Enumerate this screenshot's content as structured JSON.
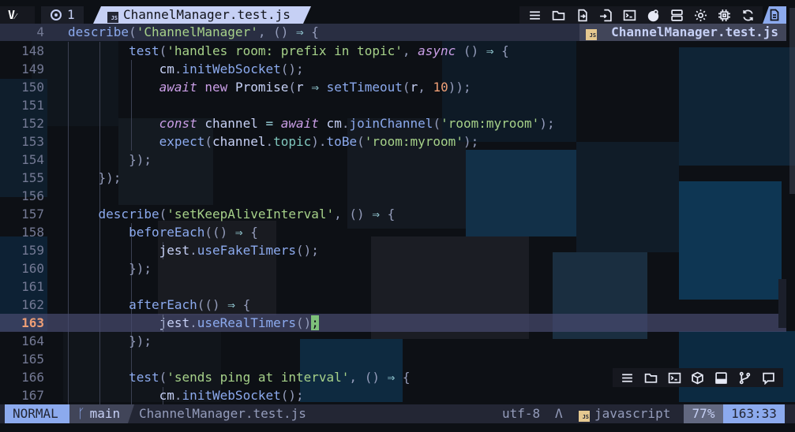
{
  "tabline": {
    "logo": "V",
    "tab_count": "1",
    "active_tab": "ChannelManager.test.js",
    "toolbar_icons": [
      "list-icon",
      "folder-icon",
      "file-move-icon",
      "file-import-icon",
      "terminal-icon",
      "theme-icon",
      "layers-icon",
      "settings-gear-icon",
      "cpu-icon",
      "refresh-icon"
    ],
    "file_button_icon": "file-text-icon"
  },
  "sticky": {
    "line_number": "4",
    "code": "describe('ChannelManager', () ⇒ {"
  },
  "winbar": {
    "filename": "ChannelManager.test.js",
    "badge": "JS"
  },
  "editor": {
    "current_line": "163",
    "lines": [
      {
        "n": "148",
        "tokens": [
          {
            "t": "        "
          },
          {
            "t": "test",
            "c": "fn"
          },
          {
            "t": "(",
            "c": "pn"
          },
          {
            "t": "'handles room: prefix in topic'",
            "c": "str"
          },
          {
            "t": ", ",
            "c": "pn"
          },
          {
            "t": "async",
            "c": "kw"
          },
          {
            "t": " () ",
            "c": "pn"
          },
          {
            "t": "⇒",
            "c": "op"
          },
          {
            "t": " {",
            "c": "pn"
          }
        ]
      },
      {
        "n": "149",
        "tokens": [
          {
            "t": "            "
          },
          {
            "t": "cm",
            "c": "var"
          },
          {
            "t": ".",
            "c": "pn"
          },
          {
            "t": "initWebSocket",
            "c": "fn"
          },
          {
            "t": "();",
            "c": "pn"
          }
        ]
      },
      {
        "n": "150",
        "tokens": [
          {
            "t": "            "
          },
          {
            "t": "await",
            "c": "kw"
          },
          {
            "t": " "
          },
          {
            "t": "new",
            "c": "kw2"
          },
          {
            "t": " "
          },
          {
            "t": "Promise",
            "c": "cls"
          },
          {
            "t": "(",
            "c": "pn"
          },
          {
            "t": "r",
            "c": "var"
          },
          {
            "t": " "
          },
          {
            "t": "⇒",
            "c": "op"
          },
          {
            "t": " "
          },
          {
            "t": "setTimeout",
            "c": "fn"
          },
          {
            "t": "(",
            "c": "pn"
          },
          {
            "t": "r",
            "c": "var"
          },
          {
            "t": ", ",
            "c": "pn"
          },
          {
            "t": "10",
            "c": "num"
          },
          {
            "t": "));",
            "c": "pn"
          }
        ]
      },
      {
        "n": "151",
        "tokens": []
      },
      {
        "n": "152",
        "tokens": [
          {
            "t": "            "
          },
          {
            "t": "const",
            "c": "kw"
          },
          {
            "t": " channel ",
            "c": "var"
          },
          {
            "t": "=",
            "c": "op"
          },
          {
            "t": " "
          },
          {
            "t": "await",
            "c": "kw"
          },
          {
            "t": " cm",
            "c": "var"
          },
          {
            "t": ".",
            "c": "pn"
          },
          {
            "t": "joinChannel",
            "c": "fn"
          },
          {
            "t": "(",
            "c": "pn"
          },
          {
            "t": "'room:myroom'",
            "c": "str"
          },
          {
            "t": ");",
            "c": "pn"
          }
        ]
      },
      {
        "n": "153",
        "tokens": [
          {
            "t": "            "
          },
          {
            "t": "expect",
            "c": "fn"
          },
          {
            "t": "(",
            "c": "pn"
          },
          {
            "t": "channel",
            "c": "var"
          },
          {
            "t": ".",
            "c": "pn"
          },
          {
            "t": "topic",
            "c": "mem"
          },
          {
            "t": ").",
            "c": "pn"
          },
          {
            "t": "toBe",
            "c": "fn"
          },
          {
            "t": "(",
            "c": "pn"
          },
          {
            "t": "'room:myroom'",
            "c": "str"
          },
          {
            "t": ");",
            "c": "pn"
          }
        ]
      },
      {
        "n": "154",
        "tokens": [
          {
            "t": "        "
          },
          {
            "t": "});",
            "c": "pn"
          }
        ]
      },
      {
        "n": "155",
        "tokens": [
          {
            "t": "    "
          },
          {
            "t": "});",
            "c": "pn"
          }
        ]
      },
      {
        "n": "156",
        "tokens": []
      },
      {
        "n": "157",
        "tokens": [
          {
            "t": "    "
          },
          {
            "t": "describe",
            "c": "fn"
          },
          {
            "t": "(",
            "c": "pn"
          },
          {
            "t": "'setKeepAliveInterval'",
            "c": "str"
          },
          {
            "t": ", () ",
            "c": "pn"
          },
          {
            "t": "⇒",
            "c": "op"
          },
          {
            "t": " {",
            "c": "pn"
          }
        ]
      },
      {
        "n": "158",
        "tokens": [
          {
            "t": "        "
          },
          {
            "t": "beforeEach",
            "c": "fn"
          },
          {
            "t": "(() ",
            "c": "pn"
          },
          {
            "t": "⇒",
            "c": "op"
          },
          {
            "t": " {",
            "c": "pn"
          }
        ]
      },
      {
        "n": "159",
        "tokens": [
          {
            "t": "            "
          },
          {
            "t": "jest",
            "c": "var"
          },
          {
            "t": ".",
            "c": "pn"
          },
          {
            "t": "useFakeTimers",
            "c": "fn"
          },
          {
            "t": "();",
            "c": "pn"
          }
        ]
      },
      {
        "n": "160",
        "tokens": [
          {
            "t": "        "
          },
          {
            "t": "});",
            "c": "pn"
          }
        ]
      },
      {
        "n": "161",
        "tokens": []
      },
      {
        "n": "162",
        "tokens": [
          {
            "t": "        "
          },
          {
            "t": "afterEach",
            "c": "fn"
          },
          {
            "t": "(() ",
            "c": "pn"
          },
          {
            "t": "⇒",
            "c": "op"
          },
          {
            "t": " {",
            "c": "pn"
          }
        ]
      },
      {
        "n": "163",
        "tokens": [
          {
            "t": "            "
          },
          {
            "t": "jest",
            "c": "var"
          },
          {
            "t": ".",
            "c": "pn"
          },
          {
            "t": "useRealTimers",
            "c": "fn"
          },
          {
            "t": "()",
            "c": "pn"
          },
          {
            "t": ";",
            "c": "cursor"
          }
        ]
      },
      {
        "n": "164",
        "tokens": [
          {
            "t": "        "
          },
          {
            "t": "});",
            "c": "pn"
          }
        ]
      },
      {
        "n": "165",
        "tokens": []
      },
      {
        "n": "166",
        "tokens": [
          {
            "t": "        "
          },
          {
            "t": "test",
            "c": "fn"
          },
          {
            "t": "(",
            "c": "pn"
          },
          {
            "t": "'sends ping at interval'",
            "c": "str"
          },
          {
            "t": ", () ",
            "c": "pn"
          },
          {
            "t": "⇒",
            "c": "op"
          },
          {
            "t": " {",
            "c": "pn"
          }
        ]
      },
      {
        "n": "167",
        "tokens": [
          {
            "t": "            "
          },
          {
            "t": "cm",
            "c": "var"
          },
          {
            "t": ".",
            "c": "pn"
          },
          {
            "t": "initWebSocket",
            "c": "fn"
          },
          {
            "t": "();",
            "c": "pn"
          }
        ]
      }
    ]
  },
  "panel": {
    "icons": [
      "list-icon",
      "folder-icon",
      "terminal-icon",
      "box-icon",
      "panel-bottom-icon",
      "git-branch-icon",
      "chat-icon"
    ]
  },
  "statusline": {
    "mode": "NORMAL",
    "branch": "main",
    "branch_icon": "git-branch-icon",
    "filename": "ChannelManager.test.js",
    "encoding": "utf-8",
    "os_icon": "Λ",
    "language_badge": "JS",
    "language": "javascript",
    "percent": "77%",
    "position": "163:33"
  },
  "colors": {
    "accent": "#8caaee",
    "string": "#a6d189",
    "keyword": "#ca9ee6",
    "number": "#ef9f76",
    "cursor": "#7dc07a",
    "badge": "#e5c890"
  }
}
